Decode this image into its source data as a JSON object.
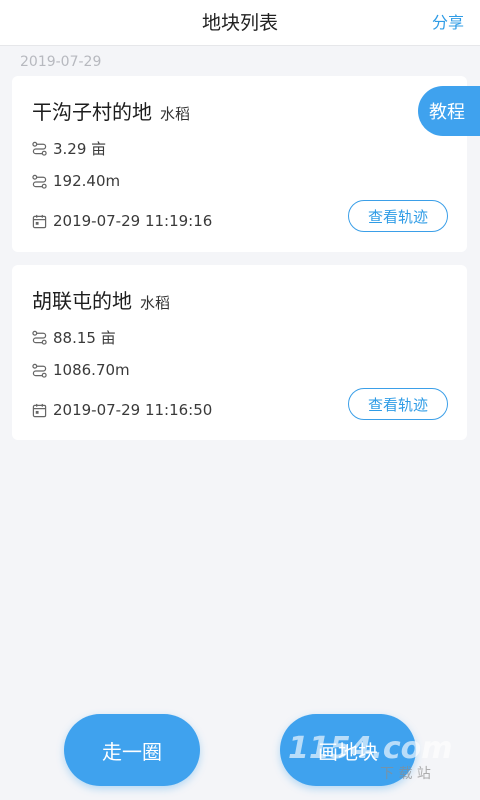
{
  "header": {
    "title": "地块列表",
    "share_label": "分享"
  },
  "list": {
    "group_date": "2019-07-29",
    "items": [
      {
        "name": "干沟子村的地",
        "crop": "水稻",
        "area": "3.29 亩",
        "length": "192.40m",
        "datetime": "2019-07-29 11:19:16",
        "track_label": "查看轨迹"
      },
      {
        "name": "胡联屯的地",
        "crop": "水稻",
        "area": "88.15 亩",
        "length": "1086.70m",
        "datetime": "2019-07-29 11:16:50",
        "track_label": "查看轨迹"
      }
    ]
  },
  "tutorial_label": "教程",
  "actions": {
    "walk_label": "走一圈",
    "draw_label": "画地块"
  },
  "watermark": {
    "text": "1154.com",
    "sub": "下 载 站"
  },
  "colors": {
    "accent": "#3fa2ee",
    "link": "#2f9ce6",
    "background": "#f4f5f8"
  }
}
